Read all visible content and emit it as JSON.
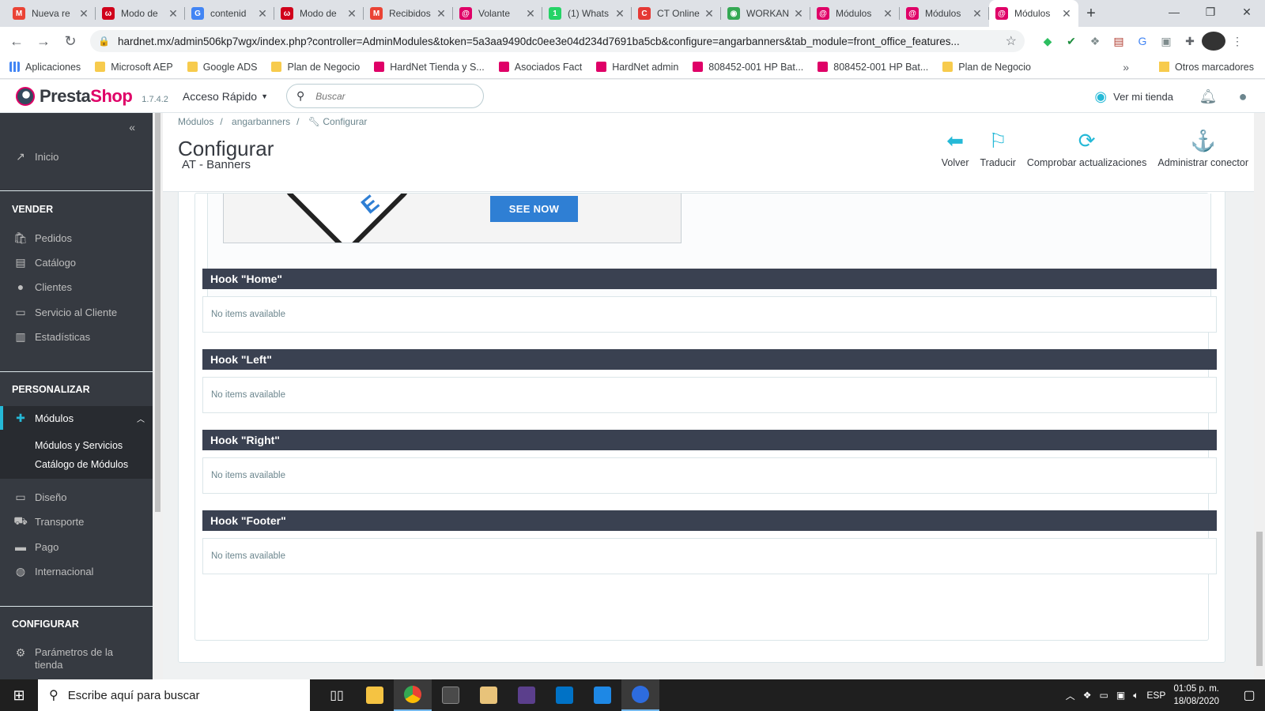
{
  "browser": {
    "tabs": [
      {
        "title": "Nueva re",
        "color": "#ea4335",
        "glyph": "M"
      },
      {
        "title": "Modo de",
        "color": "#d0021b",
        "glyph": "ω"
      },
      {
        "title": "contenid",
        "color": "#4285f4",
        "glyph": "G"
      },
      {
        "title": "Modo de",
        "color": "#d0021b",
        "glyph": "ω"
      },
      {
        "title": "Recibidos",
        "color": "#ea4335",
        "glyph": "M"
      },
      {
        "title": "Volante",
        "color": "#df0067",
        "glyph": "@"
      },
      {
        "title": "(1) Whats",
        "color": "#25d366",
        "glyph": "1"
      },
      {
        "title": "CT Online",
        "color": "#e53935",
        "glyph": "C"
      },
      {
        "title": "WORKAN",
        "color": "#34a853",
        "glyph": "◉"
      },
      {
        "title": "Módulos",
        "color": "#df0067",
        "glyph": "@"
      },
      {
        "title": "Módulos",
        "color": "#df0067",
        "glyph": "@"
      },
      {
        "title": "Módulos",
        "color": "#df0067",
        "glyph": "@",
        "active": true
      }
    ],
    "url": "hardnet.mx/admin506kp7wgx/index.php?controller=AdminModules&token=5a3aa9490dc0ee3e04d234d7691ba5cb&configure=angarbanners&tab_module=front_office_features...",
    "bookmarks": [
      {
        "label": "Aplicaciones",
        "icon": "apps-icon"
      },
      {
        "label": "Microsoft AEP",
        "icon": "folder-icon"
      },
      {
        "label": "Google ADS",
        "icon": "folder-icon"
      },
      {
        "label": "Plan de Negocio",
        "icon": "folder-icon"
      },
      {
        "label": "HardNet Tienda y S...",
        "icon": "site-icon"
      },
      {
        "label": "Asociados Fact",
        "icon": "site-icon"
      },
      {
        "label": "HardNet admin",
        "icon": "site-icon"
      },
      {
        "label": "808452-001 HP Bat...",
        "icon": "site-icon"
      },
      {
        "label": "808452-001 HP Bat...",
        "icon": "site-icon"
      },
      {
        "label": "Plan de Negocio",
        "icon": "folder-icon"
      }
    ],
    "bookmarks_more": "»",
    "other_bookmarks": "Otros marcadores"
  },
  "header": {
    "brand_a": "Presta",
    "brand_b": "Shop",
    "version": "1.7.4.2",
    "quick_access": "Acceso Rápido",
    "search_placeholder": "Buscar",
    "view_shop": "Ver mi tienda"
  },
  "sidebar": {
    "inicio": "Inicio",
    "sections": {
      "vender": "VENDER",
      "personalizar": "PERSONALIZAR",
      "configurar": "CONFIGURAR"
    },
    "vender_items": [
      "Pedidos",
      "Catálogo",
      "Clientes",
      "Servicio al Cliente",
      "Estadísticas"
    ],
    "modulos": "Módulos",
    "modulos_sub": [
      "Módulos y Servicios",
      "Catálogo de Módulos"
    ],
    "personalizar_items": [
      "Diseño",
      "Transporte",
      "Pago",
      "Internacional"
    ],
    "configurar_items": [
      "Parámetros de la tienda"
    ]
  },
  "page": {
    "breadcrumb": [
      "Módulos",
      "angarbanners",
      "Configurar"
    ],
    "title": "Configurar",
    "subtitle": "AT - Banners",
    "toolbar": [
      "Volver",
      "Traducir",
      "Comprobar actualizaciones",
      "Administrar conector"
    ],
    "banner_button": "SEE NOW",
    "banner_letter": "E",
    "hooks": [
      {
        "title": "Hook \"Home\"",
        "empty": "No items available"
      },
      {
        "title": "Hook \"Left\"",
        "empty": "No items available"
      },
      {
        "title": "Hook \"Right\"",
        "empty": "No items available"
      },
      {
        "title": "Hook \"Footer\"",
        "empty": "No items available"
      }
    ]
  },
  "taskbar": {
    "search_placeholder": "Escribe aquí para buscar",
    "language": "ESP",
    "time": "01:05 p. m.",
    "date": "18/08/2020"
  }
}
